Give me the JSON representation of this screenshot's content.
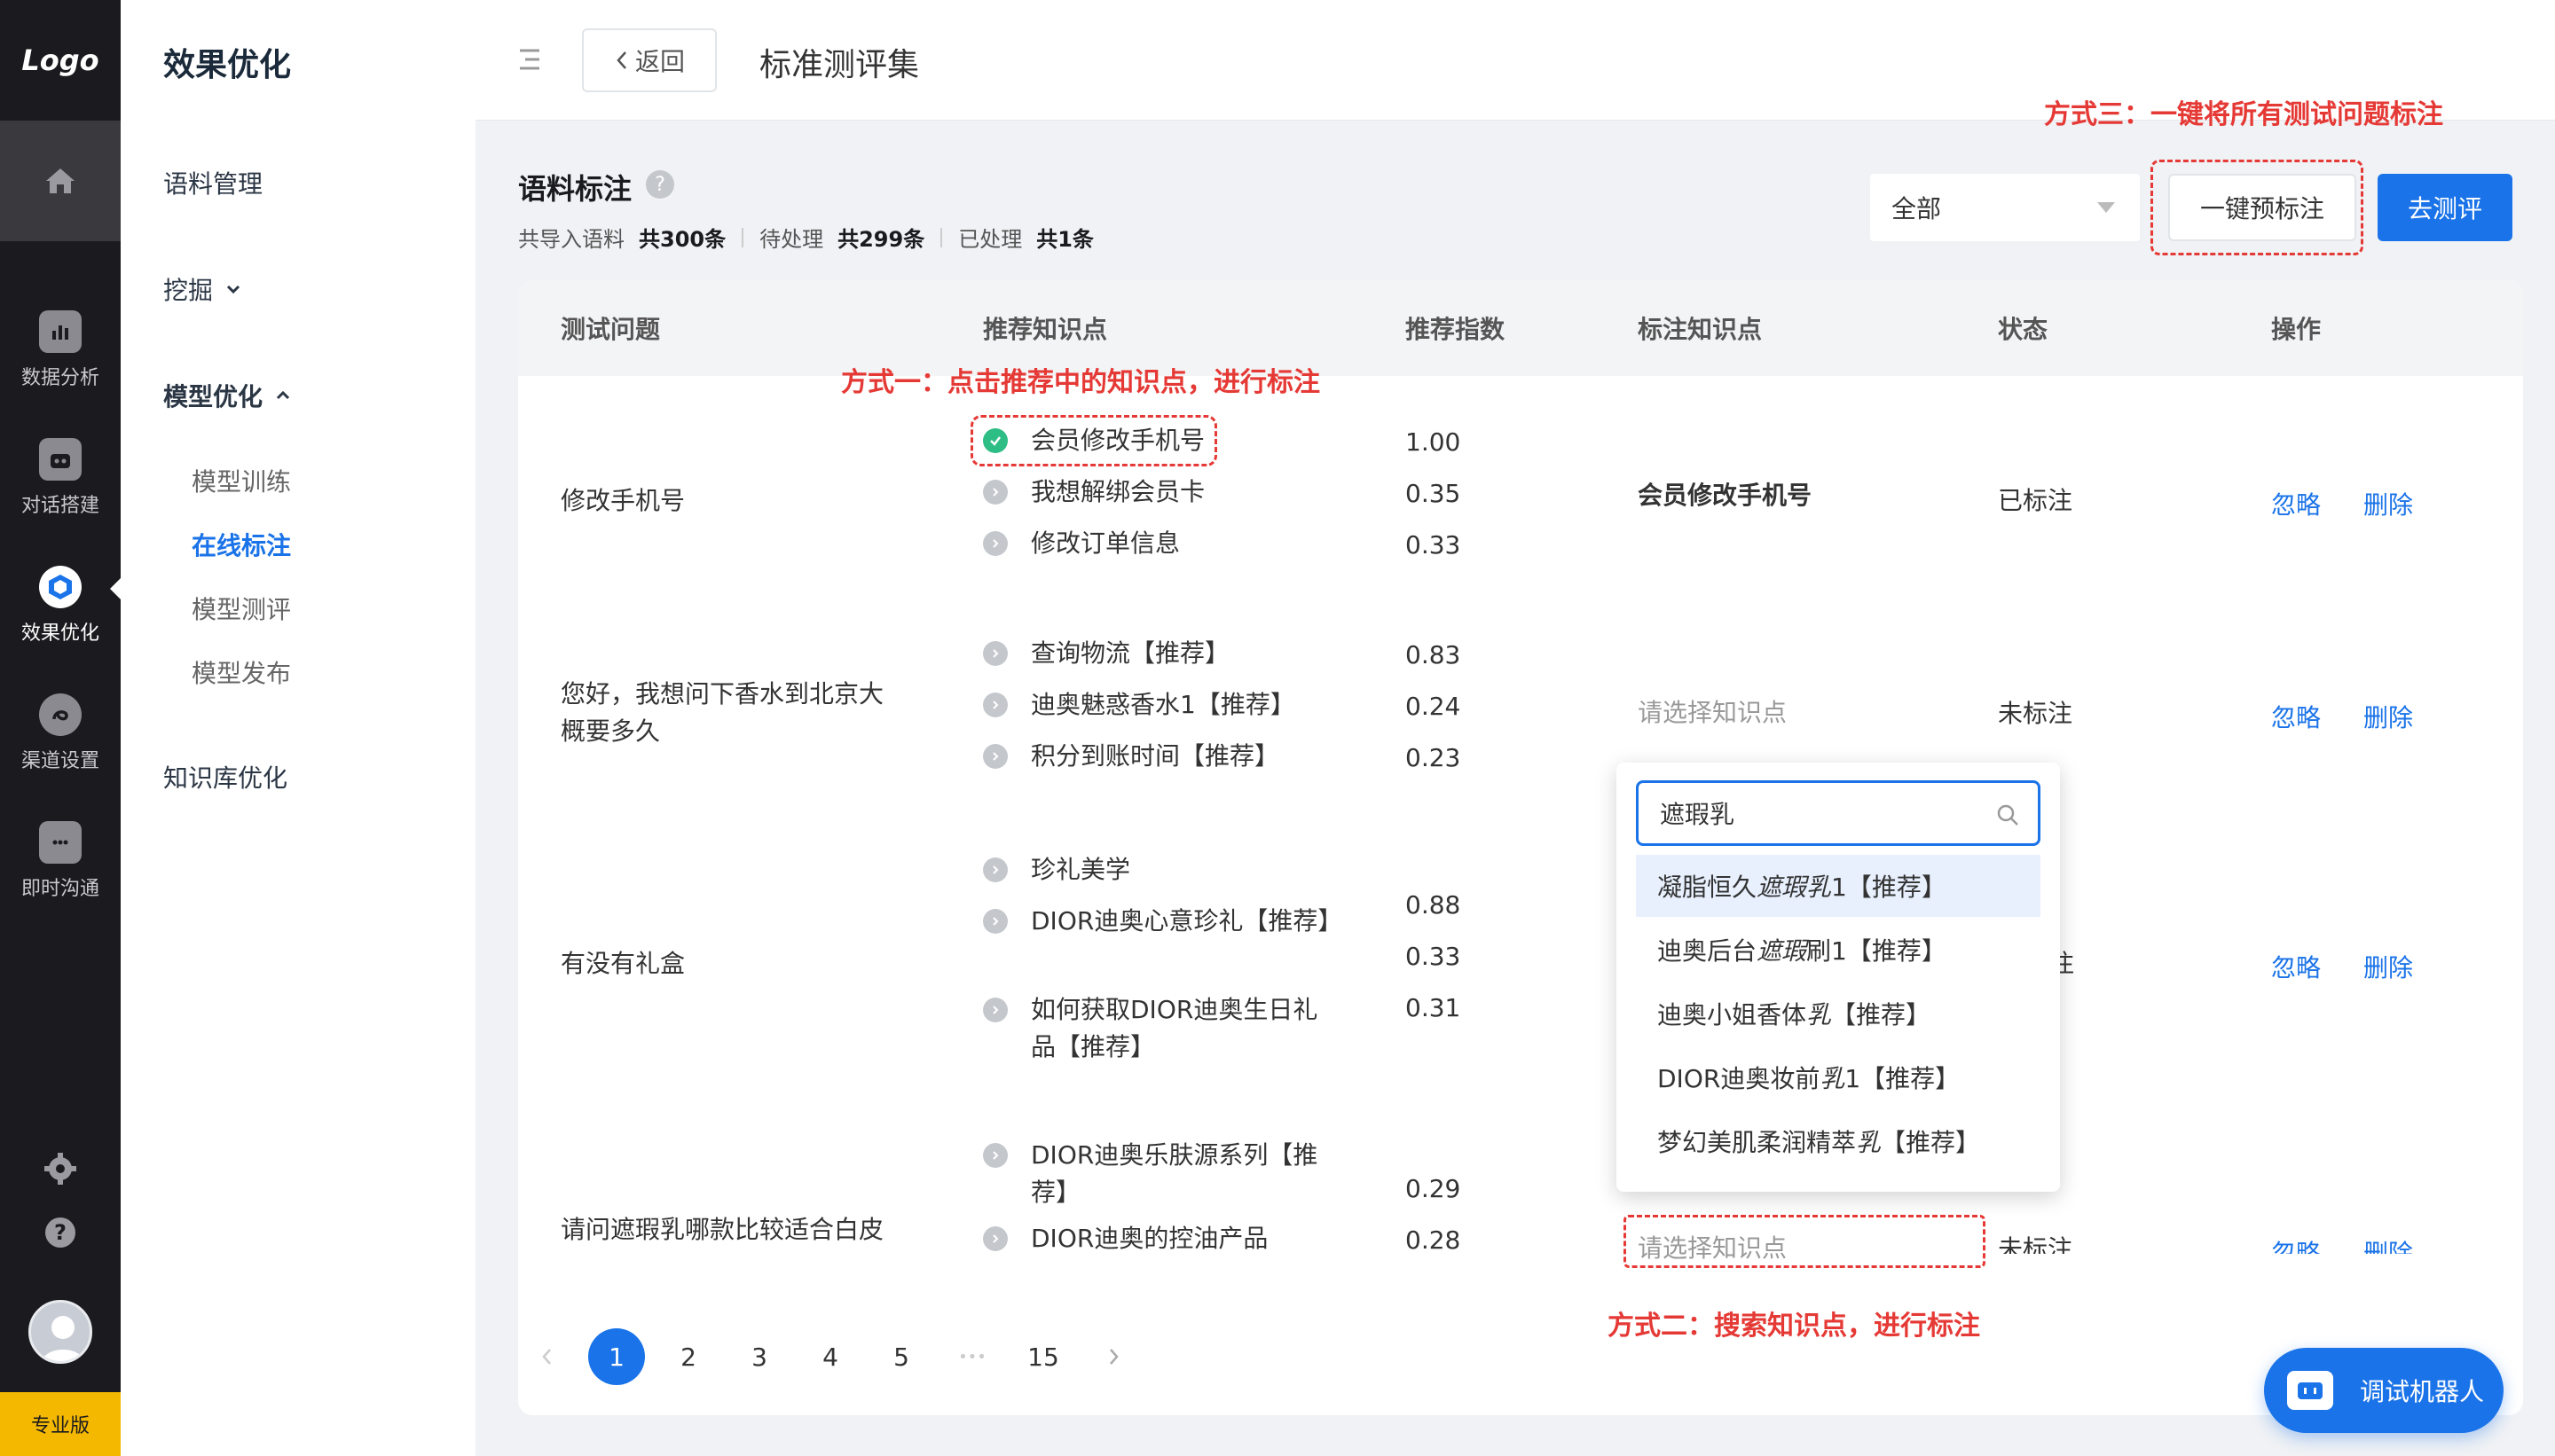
{
  "rail": {
    "logo": "Logo",
    "items": [
      {
        "label": "数据分析",
        "icon": "bar-chart-icon"
      },
      {
        "label": "对话搭建",
        "icon": "robot-icon"
      },
      {
        "label": "效果优化",
        "icon": "cube-icon"
      },
      {
        "label": "渠道设置",
        "icon": "channel-icon"
      },
      {
        "label": "即时沟通",
        "icon": "chat-icon"
      }
    ],
    "version": "专业版"
  },
  "subnav": {
    "title": "效果优化",
    "corpus": "语料管理",
    "mining": "挖掘",
    "model_opt": "模型优化",
    "model_items": [
      "模型训练",
      "在线标注",
      "模型测评",
      "模型发布"
    ],
    "kb_opt": "知识库优化"
  },
  "topbar": {
    "back": "返回",
    "title": "标准测评集"
  },
  "header": {
    "title": "语料标注",
    "stats": [
      {
        "label": "共导入语料",
        "value": "共300条"
      },
      {
        "label": "待处理",
        "value": "共299条"
      },
      {
        "label": "已处理",
        "value": "共1条"
      }
    ],
    "filter_value": "全部",
    "prelabel_button": "一键预标注",
    "eval_button": "去测评"
  },
  "annotations": {
    "method1": "方式一：点击推荐中的知识点，进行标注",
    "method2": "方式二：搜索知识点，进行标注",
    "method3": "方式三：一键将所有测试问题标注"
  },
  "table": {
    "columns": [
      "测试问题",
      "推荐知识点",
      "推荐指数",
      "标注知识点",
      "状态",
      "操作"
    ],
    "rows": [
      {
        "question": "修改手机号",
        "recs": [
          {
            "text": "会员修改手机号",
            "score": "1.00",
            "selected": true
          },
          {
            "text": "我想解绑会员卡",
            "score": "0.35",
            "selected": false
          },
          {
            "text": "修改订单信息",
            "score": "0.33",
            "selected": false
          }
        ],
        "labeled": "会员修改手机号",
        "status": "已标注"
      },
      {
        "question": "您好，我想问下香水到北京大概要多久",
        "recs": [
          {
            "text": "查询物流【推荐】",
            "score": "0.83",
            "selected": false
          },
          {
            "text": "迪奥魅惑香水1【推荐】",
            "score": "0.24",
            "selected": false
          },
          {
            "text": "积分到账时间【推荐】",
            "score": "0.23",
            "selected": false
          }
        ],
        "labeled_placeholder": "请选择知识点",
        "status": "未标注"
      },
      {
        "question": "有没有礼盒",
        "recs": [
          {
            "text": "珍礼美学",
            "selected": false
          },
          {
            "text": "DIOR迪奥心意珍礼【推荐】",
            "selected": false
          },
          {
            "text": "如何获取DIOR迪奥生日礼品【推荐】",
            "selected": false
          }
        ],
        "scores": [
          "0.88",
          "0.33",
          "0.31"
        ],
        "status_partial": "注"
      },
      {
        "question": "请问遮瑕乳哪款比较适合白皮",
        "recs": [
          {
            "text": "DIOR迪奥乐肤源系列【推荐】",
            "selected": false
          },
          {
            "text": "DIOR迪奥的控油产品",
            "selected": false
          }
        ],
        "scores": [
          "0.29",
          "0.28"
        ],
        "labeled_placeholder": "请选择知识点",
        "status": "未标注"
      }
    ],
    "actions": {
      "ignore": "忽略",
      "delete": "删除"
    }
  },
  "dropdown": {
    "query": "遮瑕乳",
    "options": [
      {
        "pre": "凝脂恒久",
        "em": "遮瑕乳",
        "post": "1【推荐】"
      },
      {
        "pre": "迪奥后台",
        "em": "遮瑕",
        "mid": "刷",
        "post": "1【推荐】"
      },
      {
        "pre": "迪奥小姐香体",
        "em": "乳",
        "post": "【推荐】"
      },
      {
        "pre": "DIOR迪奥妆前",
        "em": "乳",
        "post": "1【推荐】"
      },
      {
        "pre": "梦幻美肌柔润精萃",
        "em": "乳",
        "post": "【推荐】"
      }
    ]
  },
  "pagination": {
    "pages": [
      "1",
      "2",
      "3",
      "4",
      "5",
      "•••",
      "15"
    ],
    "current": "1"
  },
  "bot": {
    "label": "调试机器人"
  },
  "colors": {
    "primary": "#1a73e8",
    "annotation": "#e53935",
    "success": "#2ebd85",
    "rail": "#1b1b1f",
    "badge": "#f5b800"
  }
}
